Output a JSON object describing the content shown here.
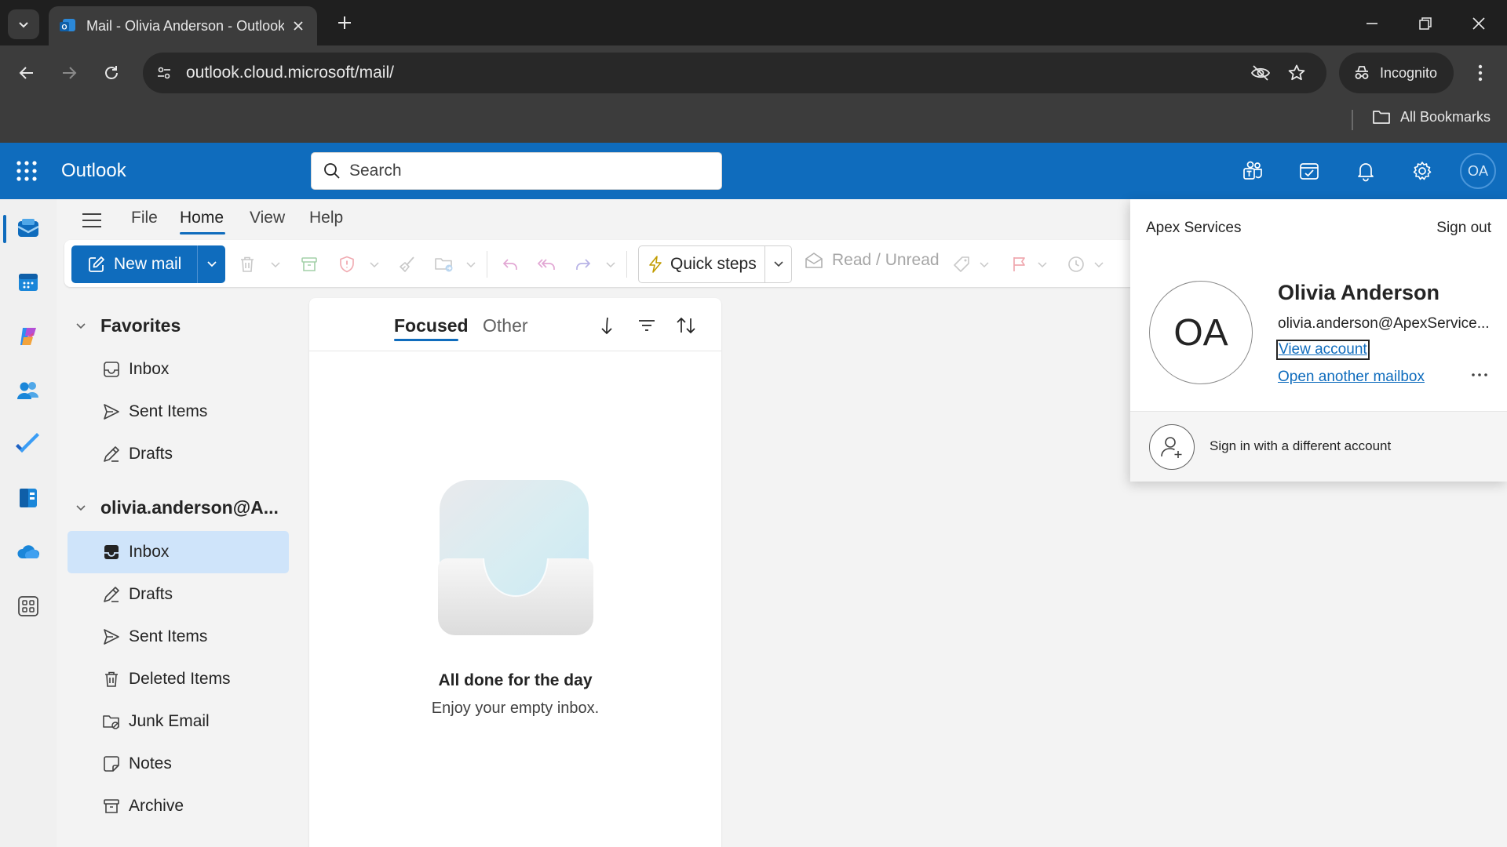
{
  "browser": {
    "tab_title": "Mail - Olivia Anderson - Outlook",
    "url": "outlook.cloud.microsoft/mail/",
    "incognito_label": "Incognito",
    "bookmarks_label": "All Bookmarks"
  },
  "header": {
    "app_name": "Outlook",
    "search_placeholder": "Search",
    "avatar_initials": "OA"
  },
  "ribbon": {
    "tabs": [
      "File",
      "Home",
      "View",
      "Help"
    ],
    "active_tab": "Home",
    "new_mail_label": "New mail",
    "quick_steps_label": "Quick steps",
    "read_unread_label": "Read / Unread"
  },
  "folders": {
    "favorites_label": "Favorites",
    "favorites": [
      {
        "label": "Inbox",
        "icon": "inbox-icon"
      },
      {
        "label": "Sent Items",
        "icon": "send-icon"
      },
      {
        "label": "Drafts",
        "icon": "drafts-icon"
      }
    ],
    "account_label": "olivia.anderson@A...",
    "account_folders": [
      {
        "label": "Inbox",
        "icon": "inbox-icon",
        "selected": true
      },
      {
        "label": "Drafts",
        "icon": "drafts-icon"
      },
      {
        "label": "Sent Items",
        "icon": "send-icon"
      },
      {
        "label": "Deleted Items",
        "icon": "trash-icon"
      },
      {
        "label": "Junk Email",
        "icon": "junk-icon"
      },
      {
        "label": "Notes",
        "icon": "note-icon"
      },
      {
        "label": "Archive",
        "icon": "archive-icon"
      }
    ]
  },
  "message_list": {
    "tab_focused": "Focused",
    "tab_other": "Other",
    "empty_title": "All done for the day",
    "empty_subtitle": "Enjoy your empty inbox."
  },
  "account_flyout": {
    "org": "Apex Services",
    "sign_out": "Sign out",
    "avatar_initials": "OA",
    "name": "Olivia Anderson",
    "email": "olivia.anderson@ApexService...",
    "view_account": "View account",
    "open_mailbox": "Open another mailbox",
    "sign_in_other": "Sign in with a different account"
  },
  "colors": {
    "brand": "#0f6cbd",
    "selected_folder": "#cfe4fa"
  }
}
